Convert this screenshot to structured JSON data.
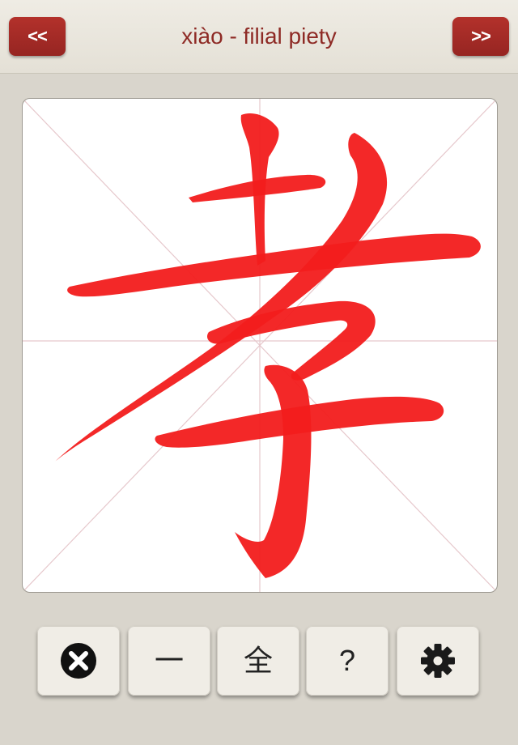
{
  "header": {
    "prev_label": "<<",
    "next_label": ">>",
    "title": "xiào - filial piety"
  },
  "practice": {
    "character": "孝",
    "stroke_color": "#f21c1c",
    "guide_color": "#e6c8cc"
  },
  "toolbar": {
    "clear_icon": "close-circle-icon",
    "one_stroke_label": "一",
    "full_label": "全",
    "hint_label": "?",
    "settings_icon": "gear-icon"
  },
  "colors": {
    "accent": "#a32b26",
    "background": "#d9d5cc",
    "title": "#8e2a25"
  }
}
